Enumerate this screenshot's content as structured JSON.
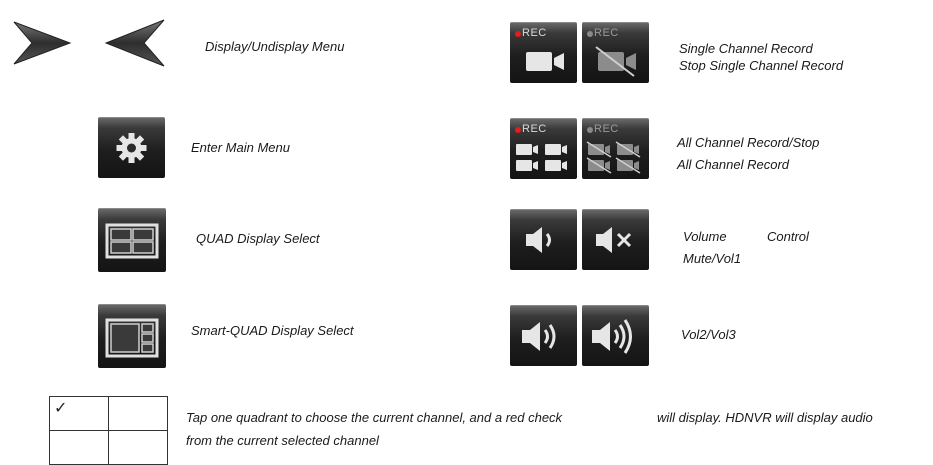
{
  "rows": {
    "menu_toggle": {
      "label": "Display/Undisplay Menu",
      "icon": "chevron-right-left-icon"
    },
    "main_menu": {
      "label": "Enter Main Menu",
      "icon": "gear-icon"
    },
    "quad": {
      "label": "QUAD Display Select",
      "icon": "quad-layout-icon"
    },
    "smart_quad": {
      "label": "Smart-QUAD Display  Select",
      "icon": "smart-quad-layout-icon"
    },
    "single_record": {
      "label_1": "Single Channel Record",
      "label_2": "Stop Single Channel Record",
      "rec_text": "REC",
      "icon": "camera-record-icon"
    },
    "all_record": {
      "label_1": "All Channel Record/Stop",
      "label_2": "All Channel Record",
      "rec_text": "REC",
      "icon": "multi-camera-record-icon"
    },
    "volume": {
      "label_1a": "Volume",
      "label_1b": "Control",
      "label_2": "Mute/Vol1",
      "icon": "speaker-icon"
    },
    "volume_levels": {
      "label": "Vol2/Vol3",
      "icon": "speaker-loud-icon"
    }
  },
  "footer": {
    "line_1a": "Tap one quadrant to choose the current channel, and a red check",
    "line_1b": "will  display.  HDNVR  will  display  audio",
    "line_2": "from the current selected channel",
    "check_mark": "✓"
  },
  "colors": {
    "rec_red": "#e02020",
    "tile_dark": "#1e1e1e",
    "chevron": "#3c3c3c"
  }
}
